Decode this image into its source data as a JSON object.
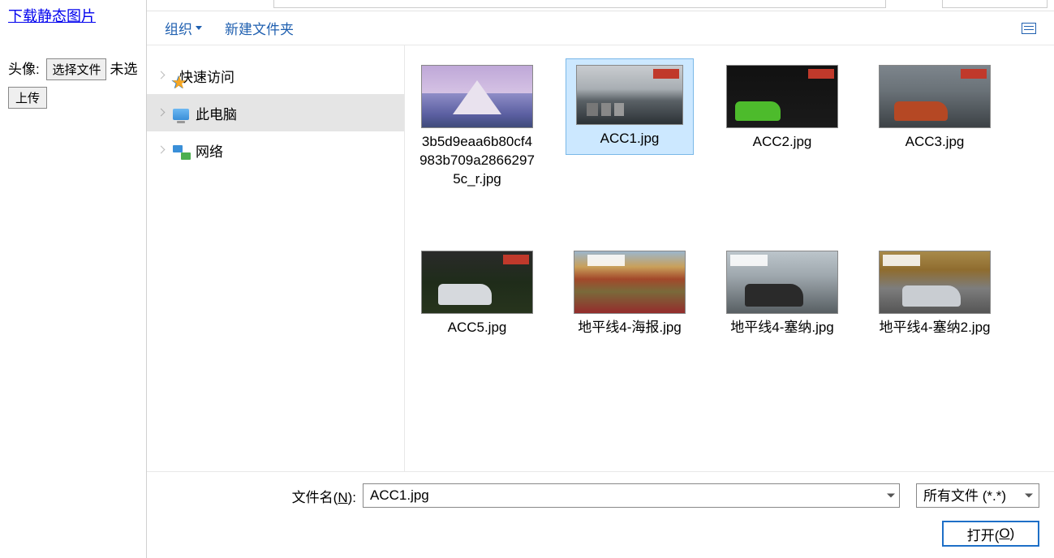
{
  "page": {
    "download_link": "下载静态图片",
    "avatar_label": "头像:",
    "choose_file": "选择文件",
    "no_file_truncated": "未选",
    "upload": "上传"
  },
  "toolbar": {
    "organize": "组织",
    "new_folder": "新建文件夹"
  },
  "tree": {
    "items": [
      {
        "label": "快速访问",
        "icon": "star"
      },
      {
        "label": "此电脑",
        "icon": "pc",
        "selected": true
      },
      {
        "label": "网络",
        "icon": "net"
      }
    ]
  },
  "files": {
    "row1": [
      {
        "name": "3b5d9eaa6b80cf4983b709a28662975c_r.jpg",
        "thumb": "th-mountain"
      },
      {
        "name": "ACC1.jpg",
        "thumb": "th-acc1",
        "selected": true
      },
      {
        "name": "ACC2.jpg",
        "thumb": "th-acc2"
      },
      {
        "name": "ACC3.jpg",
        "thumb": "th-acc3"
      }
    ],
    "row2": [
      {
        "name": "ACC5.jpg",
        "thumb": "th-acc5"
      },
      {
        "name": "地平线4-海报.jpg",
        "thumb": "th-haibao"
      },
      {
        "name": "地平线4-塞纳.jpg",
        "thumb": "th-sena1"
      },
      {
        "name": "地平线4-塞纳2.jpg",
        "thumb": "th-sena2"
      }
    ]
  },
  "footer": {
    "filename_label_pre": "文件名(",
    "filename_label_key": "N",
    "filename_label_post": "):",
    "filename_value": "ACC1.jpg",
    "filetype": "所有文件 (*.*)",
    "open_pre": "打开(",
    "open_key": "O",
    "open_post": ")"
  }
}
